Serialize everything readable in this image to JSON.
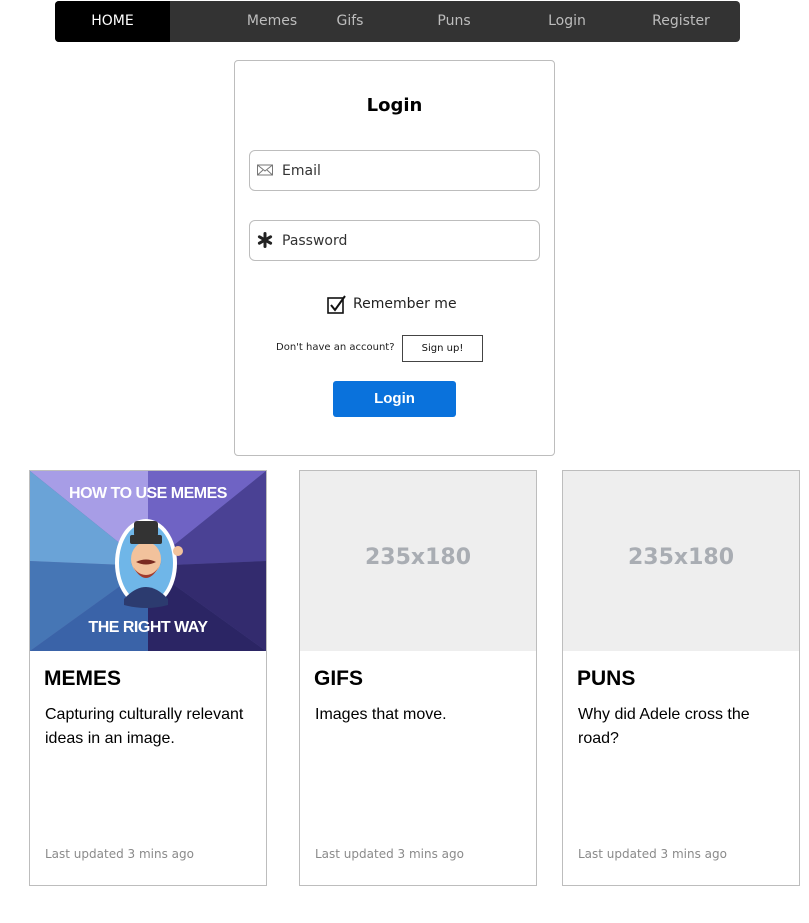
{
  "nav": {
    "items": [
      {
        "label": "HOME",
        "active": true
      },
      {
        "label": "Memes"
      },
      {
        "label": "Gifs"
      },
      {
        "label": "Puns"
      },
      {
        "label": "Login"
      },
      {
        "label": "Register"
      }
    ]
  },
  "login": {
    "title": "Login",
    "email_placeholder": "Email",
    "email_icon": "envelope-icon",
    "password_placeholder": "Password",
    "password_icon": "asterisk-icon",
    "remember_label": "Remember me",
    "remember_checked": true,
    "no_account_text": "Don't have an account?",
    "signup_label": "Sign up!",
    "submit_label": "Login",
    "accent_color": "#0a72dc"
  },
  "cards": [
    {
      "image_caption_top": "HOW TO USE MEMES",
      "image_caption_bottom": "THE RIGHT WAY",
      "title": "MEMES",
      "description": "Capturing culturally relevant ideas in an image.",
      "updated": "Last updated 3 mins ago"
    },
    {
      "image_placeholder": "235x180",
      "title": "GIFS",
      "description": "Images that move.",
      "updated": "Last updated 3 mins ago"
    },
    {
      "image_placeholder": "235x180",
      "title": "PUNS",
      "description": "Why did Adele cross the road?",
      "updated": "Last updated 3 mins ago"
    }
  ]
}
